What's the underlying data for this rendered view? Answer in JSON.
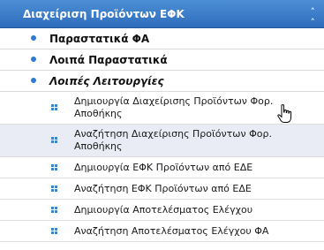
{
  "panel": {
    "title": "Διαχείριση Προϊόντων ΕΦΚ",
    "collapse_icon": "double-chevron-up-icon",
    "colors": {
      "header": "#3a7bc8",
      "bullet": "#2f7ad6",
      "hover": "#e9ecf4"
    }
  },
  "menu": [
    {
      "label": "Παραστατικά ΦΑ",
      "italic": false
    },
    {
      "label": "Λοιπά Παραστατικά",
      "italic": false
    },
    {
      "label": "Λοιπές Λειτουργίες",
      "italic": true
    }
  ],
  "submenu": [
    {
      "label": "Δημιουργία Διαχείρισης Προϊόντων Φορ. Αποθήκης",
      "hovered": false
    },
    {
      "label": "Αναζήτηση Διαχείρισης Προϊόντων Φορ. Αποθήκης",
      "hovered": true
    },
    {
      "label": "Δημιουργία ΕΦΚ Προϊόντων από ΕΔΕ",
      "hovered": false
    },
    {
      "label": "Αναζήτηση ΕΦΚ Προϊόντων από ΕΔΕ",
      "hovered": false
    },
    {
      "label": "Δημιουργία Αποτελέσματος Ελέγχου",
      "hovered": false
    },
    {
      "label": "Αναζήτηση Αποτελέσματος Ελέγχου ΦΑ",
      "hovered": false
    }
  ],
  "cursor_icon": "hand-pointer-icon"
}
